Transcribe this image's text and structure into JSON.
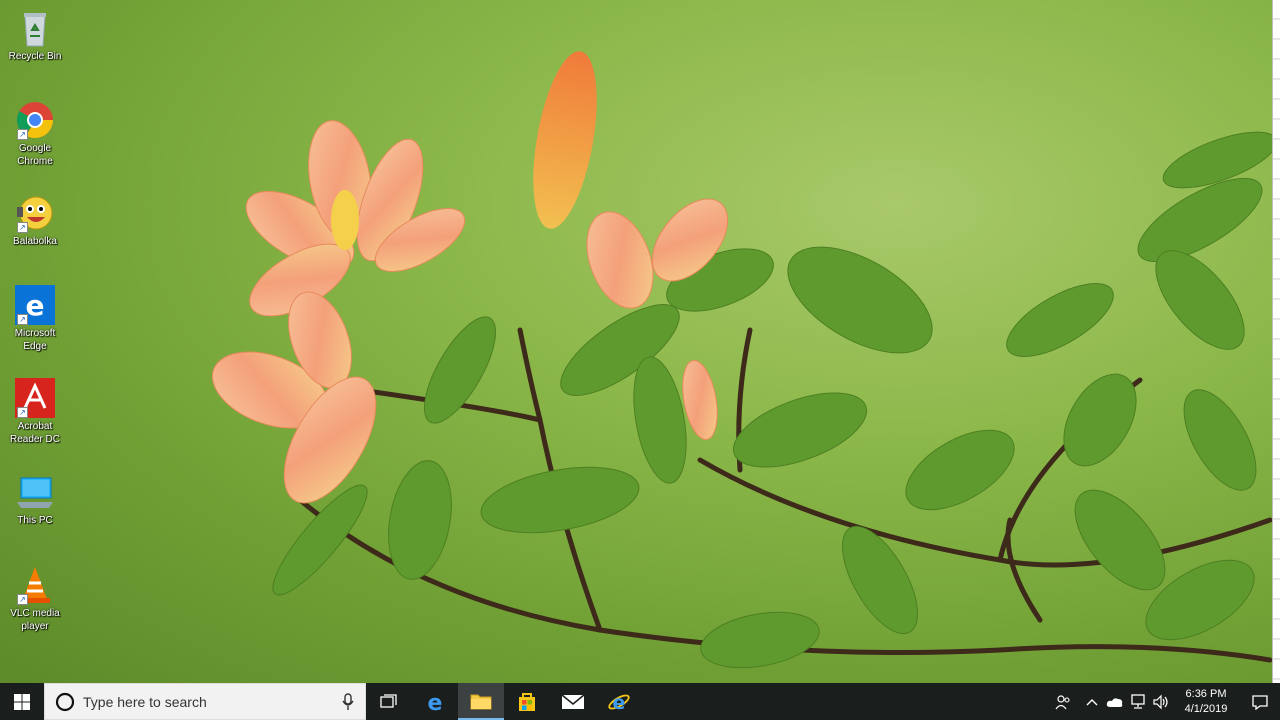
{
  "desktop_icons": [
    {
      "label": "Recycle Bin",
      "icon": "recycle-bin-icon",
      "shortcut": false
    },
    {
      "label": "Google Chrome",
      "icon": "chrome-icon",
      "shortcut": true
    },
    {
      "label": "Balabolka",
      "icon": "balabolka-icon",
      "shortcut": true
    },
    {
      "label": "Microsoft Edge",
      "icon": "edge-icon",
      "shortcut": true
    },
    {
      "label": "Acrobat Reader DC",
      "icon": "acrobat-reader-icon",
      "shortcut": true
    },
    {
      "label": "This PC",
      "icon": "this-pc-icon",
      "shortcut": false
    },
    {
      "label": "VLC media player",
      "icon": "vlc-icon",
      "shortcut": true
    }
  ],
  "taskbar": {
    "search_placeholder": "Type here to search",
    "pinned": [
      {
        "name": "task-view",
        "icon": "task-view-icon"
      },
      {
        "name": "edge",
        "icon": "edge-icon"
      },
      {
        "name": "file-explorer",
        "icon": "folder-icon",
        "active": true
      },
      {
        "name": "store",
        "icon": "store-icon"
      },
      {
        "name": "mail",
        "icon": "mail-icon"
      },
      {
        "name": "internet-explorer",
        "icon": "internet-explorer-icon"
      }
    ],
    "tray_icons": [
      "people-icon",
      "chevron-up-icon",
      "onedrive-icon",
      "network-icon",
      "volume-icon"
    ],
    "clock": {
      "time": "6:36 PM",
      "date": "4/1/2019"
    }
  },
  "colors": {
    "taskbar": "#1a1f1e",
    "accent": "#76b9ed",
    "wallpaper_green": "#8cb84a"
  }
}
